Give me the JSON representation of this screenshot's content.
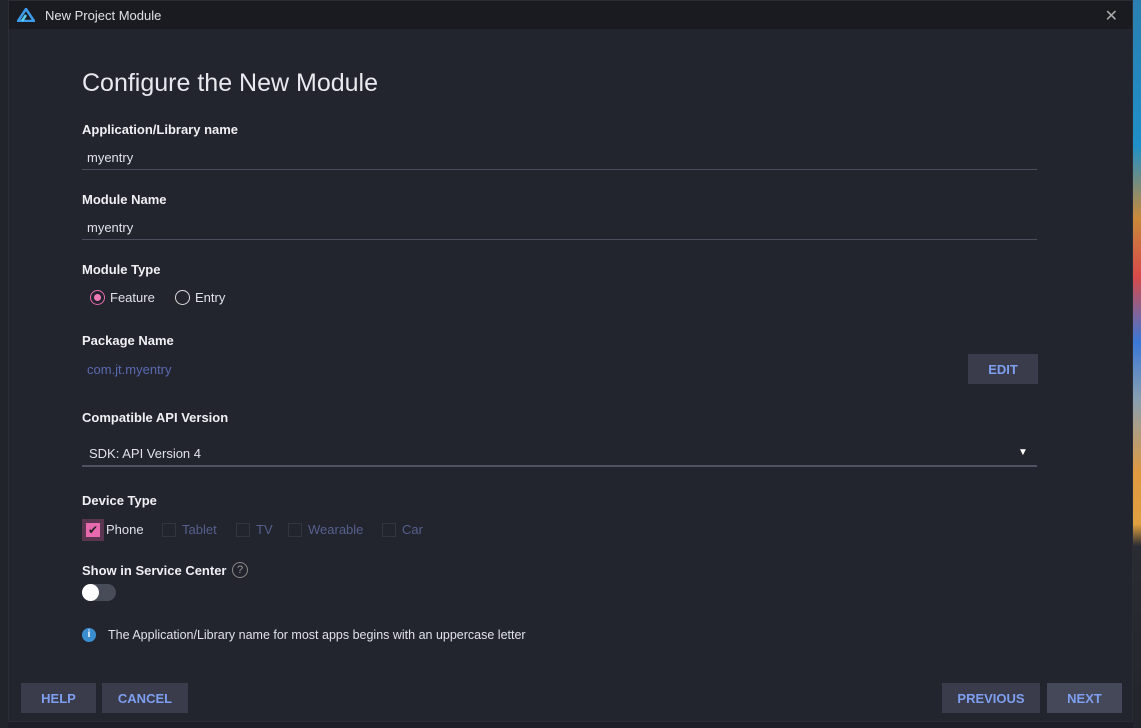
{
  "window": {
    "title": "New Project Module"
  },
  "heading": "Configure the New Module",
  "fields": {
    "app_name": {
      "label": "Application/Library name",
      "value": "myentry"
    },
    "module_name": {
      "label": "Module Name",
      "value": "myentry"
    },
    "module_type": {
      "label": "Module Type",
      "options": [
        "Feature",
        "Entry"
      ],
      "selected": "Feature"
    },
    "package_name": {
      "label": "Package Name",
      "value": "com.jt.myentry",
      "edit": "EDIT"
    },
    "api_version": {
      "label": "Compatible API Version",
      "value": "SDK: API Version 4"
    },
    "device_type": {
      "label": "Device Type",
      "options": [
        {
          "label": "Phone",
          "checked": true
        },
        {
          "label": "Tablet",
          "checked": false
        },
        {
          "label": "TV",
          "checked": false
        },
        {
          "label": "Wearable",
          "checked": false
        },
        {
          "label": "Car",
          "checked": false
        }
      ]
    },
    "service_center": {
      "label": "Show in Service Center",
      "enabled": false
    }
  },
  "info": "The Application/Library name for most apps begins with an uppercase letter",
  "buttons": {
    "help": "HELP",
    "cancel": "CANCEL",
    "previous": "PREVIOUS",
    "next": "NEXT"
  },
  "colors": {
    "accent": "#e76aae",
    "button_text": "#7e9ff0",
    "background": "#22242e"
  }
}
